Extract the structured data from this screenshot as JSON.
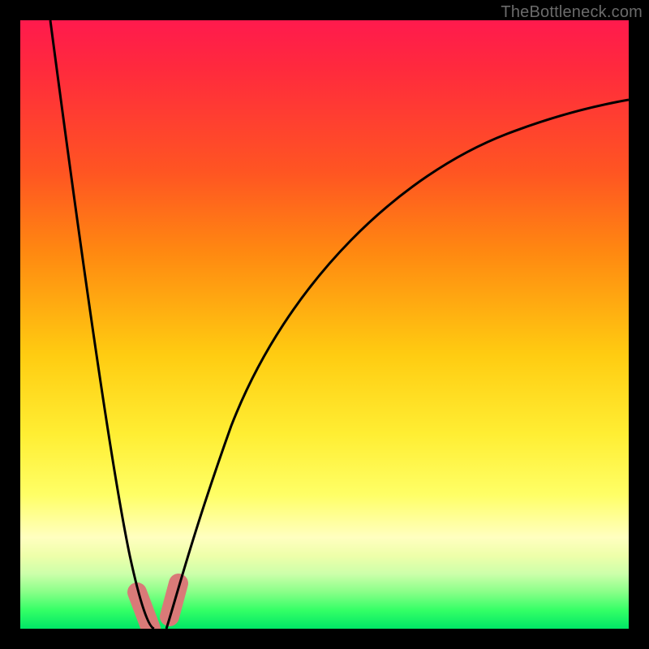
{
  "watermark": "TheBottleneck.com",
  "colors": {
    "gradient_top": "#ff1a4d",
    "gradient_mid": "#ffee33",
    "gradient_bottom": "#00e666",
    "curve": "#000000",
    "marker": "#d97a78",
    "frame_bg": "#000000"
  },
  "chart_data": {
    "type": "line",
    "title": "",
    "xlabel": "",
    "ylabel": "",
    "xlim": [
      0,
      1
    ],
    "ylim": [
      0,
      1
    ],
    "grid": false,
    "notes": "Two bottleneck curves plotted over a heat gradient. Approximate y (bottleneck %) as function of x (component ratio), read from pixel positions. Optimum (y≈0) occurs near x≈0.20–0.24.",
    "series": [
      {
        "name": "left_curve",
        "x": [
          0.05,
          0.075,
          0.1,
          0.125,
          0.15,
          0.175,
          0.2,
          0.22
        ],
        "y": [
          1.0,
          0.79,
          0.59,
          0.4,
          0.22,
          0.09,
          0.025,
          0.0
        ]
      },
      {
        "name": "right_curve",
        "x": [
          0.24,
          0.26,
          0.3,
          0.35,
          0.4,
          0.5,
          0.6,
          0.7,
          0.8,
          0.9,
          1.0
        ],
        "y": [
          0.0,
          0.045,
          0.185,
          0.335,
          0.45,
          0.6,
          0.695,
          0.76,
          0.805,
          0.84,
          0.87
        ]
      }
    ],
    "markers": [
      {
        "name": "left_marker_segment",
        "x": [
          0.192,
          0.215
        ],
        "y": [
          0.06,
          0.0
        ]
      },
      {
        "name": "right_marker_segment",
        "x": [
          0.245,
          0.26
        ],
        "y": [
          0.02,
          0.075
        ]
      }
    ]
  }
}
